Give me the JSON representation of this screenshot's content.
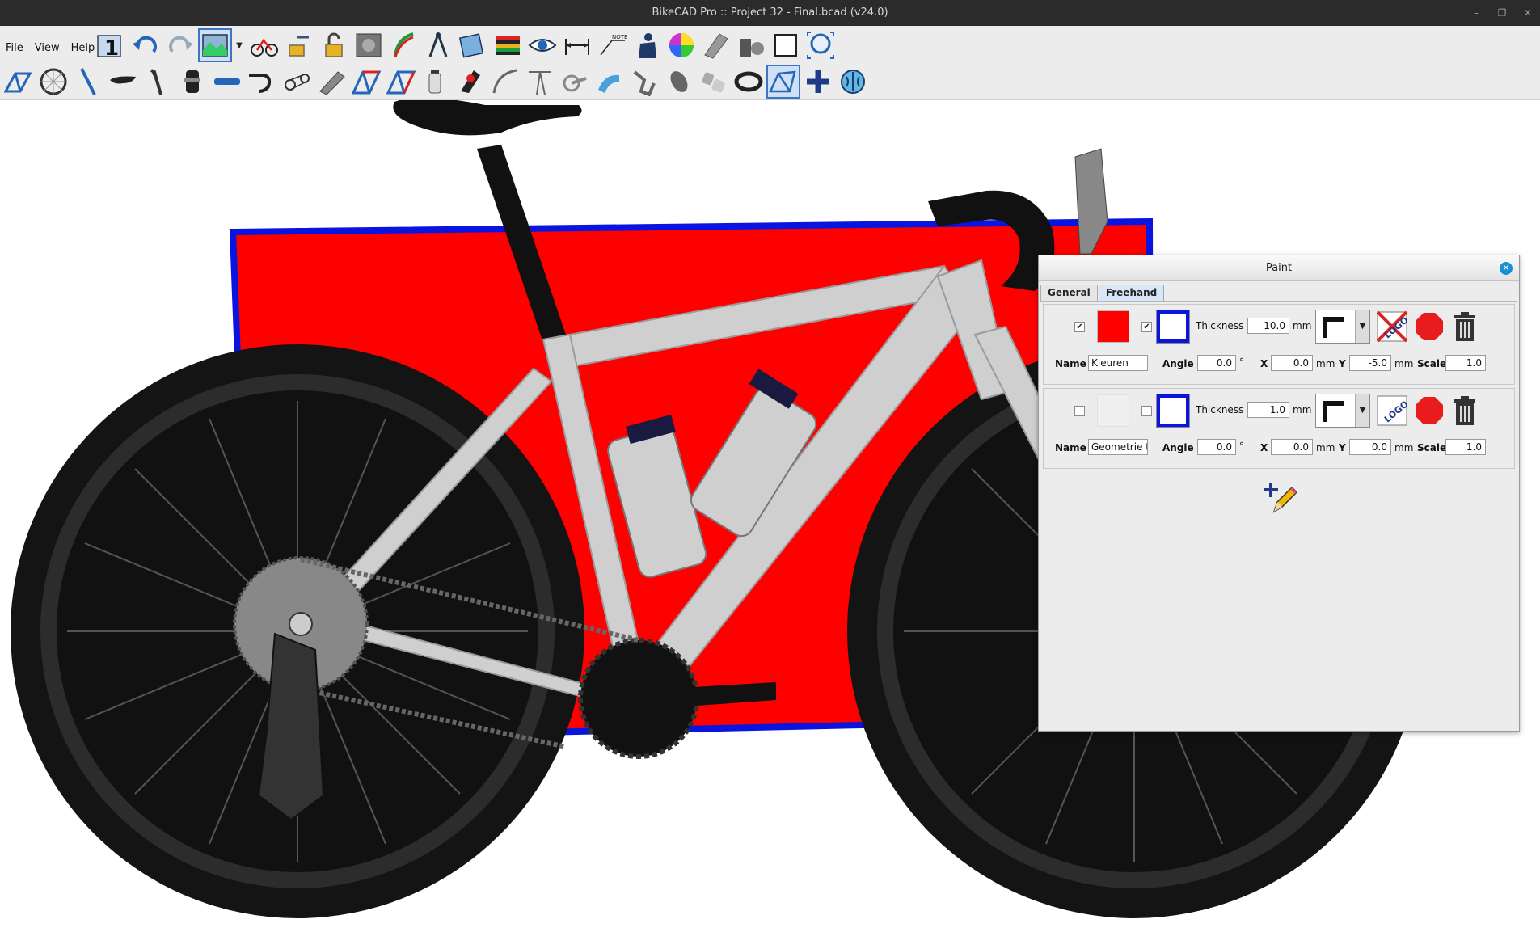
{
  "window": {
    "title": "BikeCAD Pro :: Project 32 - Final.bcad (v24.0)",
    "controls": [
      "–",
      "❐",
      "✕"
    ]
  },
  "menu": [
    "File",
    "View",
    "Help"
  ],
  "toolbar_row1": [
    {
      "icon": "step-one-icon",
      "selected": false
    },
    {
      "icon": "undo-icon",
      "selected": false
    },
    {
      "icon": "redo-icon",
      "selected": false
    },
    {
      "icon": "background-image-icon",
      "selected": true
    },
    {
      "icon": "bike-dimension-icon",
      "selected": false
    },
    {
      "icon": "tool-lock-icon",
      "selected": false
    },
    {
      "icon": "unlock-icon",
      "selected": false
    },
    {
      "icon": "photo-icon",
      "selected": false
    },
    {
      "icon": "pen-icon",
      "selected": false
    },
    {
      "icon": "compass-icon",
      "selected": false
    },
    {
      "icon": "notebook-icon",
      "selected": false
    },
    {
      "icon": "color-bars-icon",
      "selected": false
    },
    {
      "icon": "eye-icon",
      "selected": false
    },
    {
      "icon": "dimension-icon",
      "selected": false
    },
    {
      "icon": "note-icon",
      "selected": false
    },
    {
      "icon": "rider-icon",
      "selected": false
    },
    {
      "icon": "color-wheel-icon",
      "selected": false
    },
    {
      "icon": "component-grey-icon",
      "selected": false
    },
    {
      "icon": "shapes-icon",
      "selected": false
    },
    {
      "icon": "square-icon",
      "selected": false
    },
    {
      "icon": "zoom-fit-icon",
      "selected": false
    }
  ],
  "toolbar_row2": [
    {
      "icon": "frame-icon",
      "selected": false
    },
    {
      "icon": "wheel-icon",
      "selected": false
    },
    {
      "icon": "fork-icon",
      "selected": false
    },
    {
      "icon": "saddle-icon",
      "selected": false
    },
    {
      "icon": "seatpost-icon",
      "selected": false
    },
    {
      "icon": "headset-icon",
      "selected": false
    },
    {
      "icon": "stem-icon",
      "selected": false
    },
    {
      "icon": "handlebar-icon",
      "selected": false
    },
    {
      "icon": "drivetrain-icon",
      "selected": false
    },
    {
      "icon": "tube-icon",
      "selected": false
    },
    {
      "icon": "frame-red-icon",
      "selected": false
    },
    {
      "icon": "frame-blue-icon",
      "selected": false
    },
    {
      "icon": "bottle-icon",
      "selected": false
    },
    {
      "icon": "brake-icon",
      "selected": false
    },
    {
      "icon": "arc-icon",
      "selected": false
    },
    {
      "icon": "fork-rake-icon",
      "selected": false
    },
    {
      "icon": "crankset-icon",
      "selected": false
    },
    {
      "icon": "suspension-icon",
      "selected": false
    },
    {
      "icon": "derailleur-icon",
      "selected": false
    },
    {
      "icon": "mouse-icon",
      "selected": false
    },
    {
      "icon": "hub-icon",
      "selected": false
    },
    {
      "icon": "tire-icon",
      "selected": false
    },
    {
      "icon": "frame-outline-icon",
      "selected": true
    },
    {
      "icon": "add-icon",
      "selected": false
    },
    {
      "icon": "brain-icon",
      "selected": false
    }
  ],
  "colors": {
    "paint_red": "#ff0000",
    "outline_blue": "#0a14e0",
    "frame_grey": "#cfcfcf",
    "tire_black": "#111111"
  },
  "paint_panel": {
    "title": "Paint",
    "close_icon": "close-icon",
    "tabs": [
      {
        "label": "General",
        "active": false
      },
      {
        "label": "Freehand",
        "active": true
      }
    ],
    "labels": {
      "thickness": "Thickness",
      "mm": "mm",
      "name": "Name",
      "angle": "Angle",
      "degree": "°",
      "x": "X",
      "y": "Y",
      "scale": "Scale"
    },
    "layers": [
      {
        "fill_checked": true,
        "fill_check_glyph": "✔",
        "fill_color": "#ff0000",
        "stroke_checked": true,
        "stroke_check_glyph": "✔",
        "stroke_color": "#0a14e0",
        "thickness": "10.0",
        "name": "Kleuren",
        "angle": "0.0",
        "x": "0.0",
        "y": "-5.0",
        "scale": "1.0"
      },
      {
        "fill_checked": false,
        "fill_check_glyph": "",
        "fill_color": "#efefef",
        "stroke_checked": false,
        "stroke_check_glyph": "",
        "stroke_color": "#0a14e0",
        "thickness": "1.0",
        "name": "Geometrie t",
        "angle": "0.0",
        "x": "0.0",
        "y": "0.0",
        "scale": "1.0"
      }
    ],
    "add_layer_icon": "add-layer-pencil-icon"
  }
}
